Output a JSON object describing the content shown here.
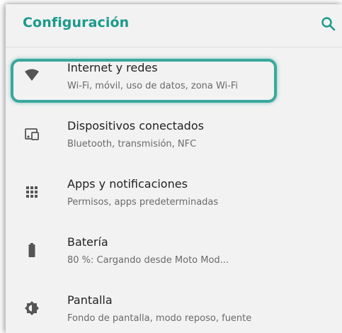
{
  "appbar": {
    "title": "Configuración",
    "search_icon": "search-icon"
  },
  "colors": {
    "accent": "#1a9a8c",
    "highlight": "#3aa89e",
    "icon": "#555555",
    "background": "#f2f2f2"
  },
  "settings": {
    "items": [
      {
        "title": "Internet y redes",
        "subtitle": "Wi-Fi, móvil, uso de datos, zona Wi-Fi",
        "icon": "wifi-icon"
      },
      {
        "title": "Dispositivos conectados",
        "subtitle": "Bluetooth, transmisión, NFC",
        "icon": "devices-icon"
      },
      {
        "title": "Apps y notificaciones",
        "subtitle": "Permisos, apps predeterminadas",
        "icon": "apps-grid-icon"
      },
      {
        "title": "Batería",
        "subtitle": "80 %: Cargando desde Moto Mod...",
        "icon": "battery-icon"
      },
      {
        "title": "Pantalla",
        "subtitle": "Fondo de pantalla, modo reposo, fuente",
        "icon": "brightness-icon"
      }
    ]
  }
}
